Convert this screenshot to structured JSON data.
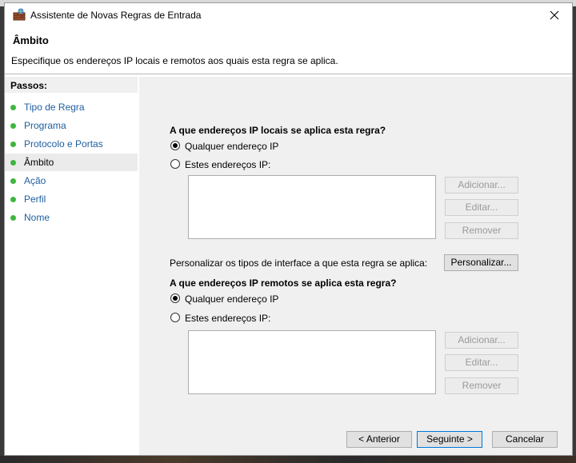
{
  "window": {
    "title": "Assistente de Novas Regras de Entrada",
    "close_glyph": "✕"
  },
  "header": {
    "title": "Âmbito",
    "description": "Especifique os endereços IP locais e remotos aos quais esta regra se aplica."
  },
  "sidebar": {
    "label": "Passos:",
    "active_index": 3,
    "items": [
      {
        "label": "Tipo de Regra"
      },
      {
        "label": "Programa"
      },
      {
        "label": "Protocolo e Portas"
      },
      {
        "label": "Âmbito"
      },
      {
        "label": "Ação"
      },
      {
        "label": "Perfil"
      },
      {
        "label": "Nome"
      }
    ]
  },
  "local": {
    "question": "A que endereços IP locais se aplica esta regra?",
    "option_any": "Qualquer endereço IP",
    "option_these": "Estes endereços IP:",
    "selected": "any",
    "add": "Adicionar...",
    "edit": "Editar...",
    "remove": "Remover"
  },
  "interface": {
    "label": "Personalizar os tipos de interface a que esta regra se aplica:",
    "button": "Personalizar..."
  },
  "remote": {
    "question": "A que endereços IP remotos se aplica esta regra?",
    "option_any": "Qualquer endereço IP",
    "option_these": "Estes endereços IP:",
    "selected": "any",
    "add": "Adicionar...",
    "edit": "Editar...",
    "remove": "Remover"
  },
  "footer": {
    "back": "< Anterior",
    "next": "Seguinte >",
    "cancel": "Cancelar"
  },
  "colors": {
    "step_dot": "#3fb63f",
    "step_link": "#1f5fa0",
    "primary_border": "#0078d7"
  }
}
